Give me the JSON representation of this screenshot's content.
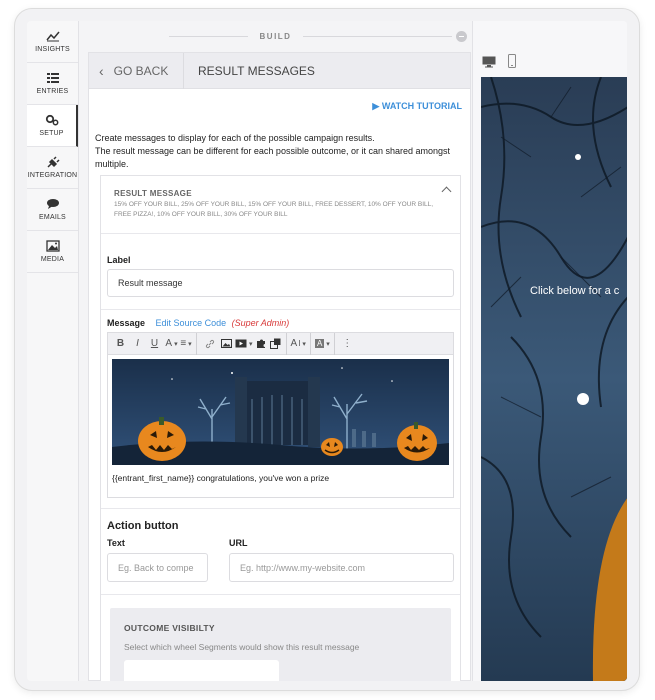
{
  "sidebar": {
    "items": [
      {
        "label": "INSIGHTS",
        "icon": "chart-line-icon"
      },
      {
        "label": "ENTRIES",
        "icon": "list-icon"
      },
      {
        "label": "SETUP",
        "icon": "gears-icon",
        "active": true
      },
      {
        "label": "INTEGRATION",
        "icon": "plug-icon"
      },
      {
        "label": "EMAILS",
        "icon": "chat-bubble-icon"
      },
      {
        "label": "MEDIA",
        "icon": "image-icon"
      }
    ]
  },
  "build": {
    "title": "BUILD"
  },
  "panel": {
    "back_label": "GO BACK",
    "title": "RESULT MESSAGES",
    "tutorial_label": "▶ WATCH TUTORIAL",
    "description_line1": "Create messages to display for each of the possible campaign results.",
    "description_line2": "The result message can be different for each possible outcome, or it can shared amongst multiple."
  },
  "result_message": {
    "title": "RESULT MESSAGE",
    "summary": "15% OFF YOUR BILL, 25% OFF YOUR BILL, 15% OFF YOUR BILL, FREE DESSERT, 10% OFF YOUR BILL, FREE PIZZA!, 10% OFF YOUR BILL, 30% OFF YOUR BILL",
    "label_field": {
      "label": "Label",
      "value": "Result message"
    },
    "message_field": {
      "label": "Message",
      "edit_source": "Edit Source Code",
      "admin_note": "(Super Admin)",
      "body_text": "{{entrant_first_name}} congratulations, you've won a prize"
    },
    "action_button": {
      "title": "Action button",
      "text_label": "Text",
      "text_placeholder": "Eg. Back to compe",
      "url_label": "URL",
      "url_placeholder": "Eg. http://www.my-website.com"
    },
    "outcome": {
      "title": "OUTCOME VISIBILTY",
      "subtitle": "Select which wheel Segments would show this result message"
    }
  },
  "toolbar": {
    "bold": "B",
    "italic": "I",
    "underline": "U",
    "font_color": "A",
    "align": "≡",
    "font_size": "A",
    "bg_color": "A",
    "more": "⋮"
  },
  "preview": {
    "headline": "Click below for a c"
  },
  "colors": {
    "accent": "#3d8fd9",
    "admin_red": "#d83a3a",
    "preview_bg": "#1e3042"
  }
}
